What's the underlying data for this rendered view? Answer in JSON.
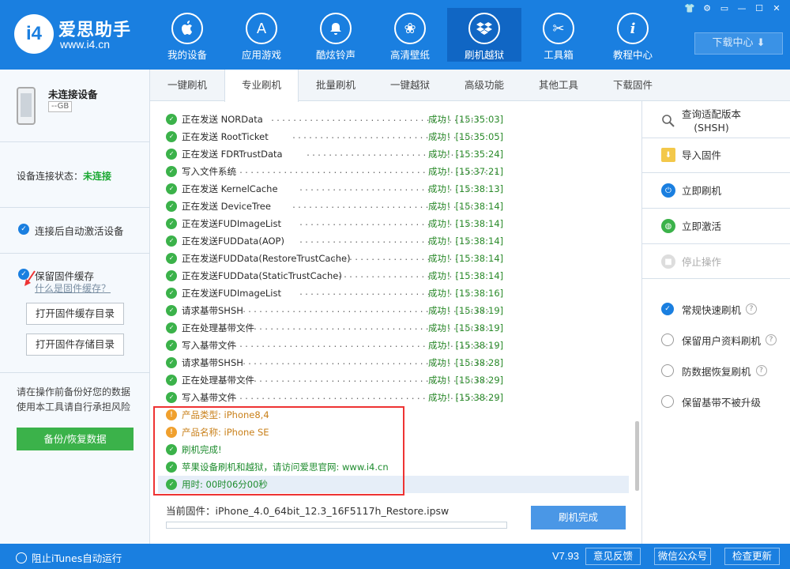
{
  "app": {
    "logo_mark": "i4",
    "name": "爱思助手",
    "url": "www.i4.cn",
    "accent": "#1a7fe0"
  },
  "nav": [
    {
      "label": "我的设备",
      "icon": "apple-icon",
      "glyph": ""
    },
    {
      "label": "应用游戏",
      "icon": "app-store-icon",
      "glyph": "A"
    },
    {
      "label": "酷炫铃声",
      "icon": "bell-icon",
      "glyph": "🔔"
    },
    {
      "label": "高清壁纸",
      "icon": "flower-icon",
      "glyph": "❀"
    },
    {
      "label": "刷机越狱",
      "icon": "dropbox-icon",
      "glyph": "◈"
    },
    {
      "label": "工具箱",
      "icon": "tools-icon",
      "glyph": "✂"
    },
    {
      "label": "教程中心",
      "icon": "info-icon",
      "glyph": "i"
    }
  ],
  "window": {
    "controls": [
      "👕",
      "⚙",
      "▭",
      "—",
      "☐",
      "✕"
    ],
    "download_center": "下载中心 ⬇"
  },
  "device": {
    "name": "未连接设备",
    "capacity": "--GB"
  },
  "connection": {
    "label": "设备连接状态：",
    "value": "未连接",
    "value_color": "#1aa832"
  },
  "options": {
    "auto_activate": "连接后自动激活设备",
    "keep_cache": "保留固件缓存",
    "what_is_cache": "什么是固件缓存？",
    "open_cache_dir": "打开固件缓存目录",
    "open_storage_dir": "打开固件存储目录"
  },
  "warning": "请在操作前备份好您的数据\n使用本工具请自行承担风险",
  "backup_button": "备份/恢复数据",
  "tabs": [
    "一键刷机",
    "专业刷机",
    "批量刷机",
    "一键越狱",
    "高级功能",
    "其他工具",
    "下载固件"
  ],
  "active_tab": 1,
  "log": [
    {
      "text": "正在发送 NORData",
      "result": "成功！[15:35:03]"
    },
    {
      "text": "正在发送 RootTicket",
      "result": "成功！[15:35:05]"
    },
    {
      "text": "正在发送 FDRTrustData",
      "result": "成功！[15:35:24]"
    },
    {
      "text": "写入文件系统",
      "result": "成功！[15:37:21]"
    },
    {
      "text": "正在发送 KernelCache",
      "result": "成功！[15:38:13]"
    },
    {
      "text": "正在发送 DeviceTree",
      "result": "成功！[15:38:14]"
    },
    {
      "text": "正在发送FUDImageList",
      "result": "成功！[15:38:14]"
    },
    {
      "text": "正在发送FUDData(AOP)",
      "result": "成功！[15:38:14]"
    },
    {
      "text": "正在发送FUDData(RestoreTrustCache)",
      "result": "成功！[15:38:14]"
    },
    {
      "text": "正在发送FUDData(StaticTrustCache)",
      "result": "成功！[15:38:14]"
    },
    {
      "text": "正在发送FUDImageList",
      "result": "成功！[15:38:16]"
    },
    {
      "text": "请求基带SHSH",
      "result": "成功！[15:38:19]"
    },
    {
      "text": "正在处理基带文件",
      "result": "成功！[15:38:19]"
    },
    {
      "text": "写入基带文件",
      "result": "成功！[15:38:19]"
    },
    {
      "text": "请求基带SHSH",
      "result": "成功！[15:38:28]"
    },
    {
      "text": "正在处理基带文件",
      "result": "成功！[15:38:29]"
    },
    {
      "text": "写入基带文件",
      "result": "成功！[15:38:29]"
    }
  ],
  "summary": {
    "product_type": "产品类型: iPhone8,4",
    "product_name": "产品名称: iPhone SE",
    "flash_done": "刷机完成!",
    "visit": "苹果设备刷机和越狱，请访问爱思官网: www.i4.cn",
    "elapsed": "用时: 00时06分00秒"
  },
  "current_firmware": "当前固件：iPhone_4.0_64bit_12.3_16F5117h_Restore.ipsw",
  "progress": 0,
  "done_button": "刷机完成",
  "actions": {
    "query_shsh": "查询适配版本\n(SHSH)",
    "import_firmware": "导入固件",
    "flash_now": "立即刷机",
    "activate_now": "立即激活",
    "stop": "停止操作"
  },
  "modes": [
    {
      "label": "常规快速刷机",
      "selected": true
    },
    {
      "label": "保留用户资料刷机",
      "selected": false
    },
    {
      "label": "防数据恢复刷机",
      "selected": false
    },
    {
      "label": "保留基带不被升级",
      "selected": false
    }
  ],
  "footer": {
    "block_itunes": "阻止iTunes自动运行",
    "version": "V7.93",
    "feedback": "意见反馈",
    "wechat": "微信公众号",
    "update": "检查更新"
  }
}
